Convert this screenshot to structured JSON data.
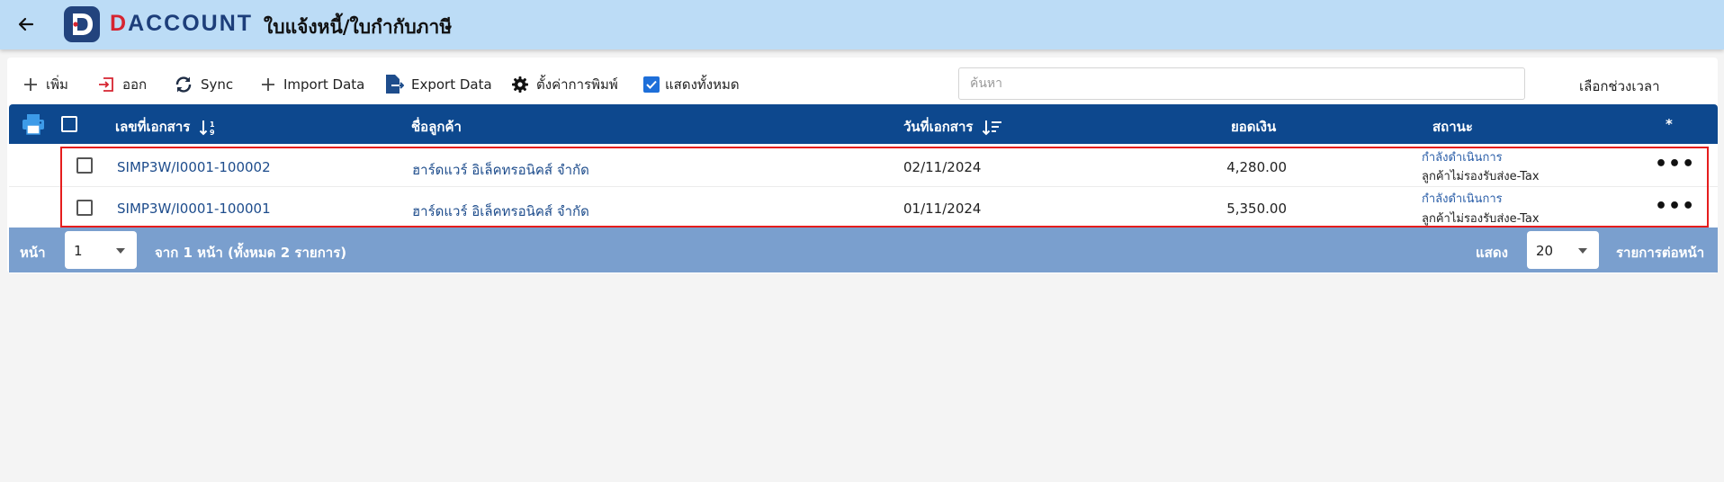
{
  "appbar": {
    "logo_red": "D",
    "logo_blue": "ACCOUNT",
    "title": "ใบแจ้งหนี้/ใบกำกับภาษี"
  },
  "toolbar": {
    "add_label": "เพิ่ม",
    "exit_label": "ออก",
    "sync_label": "Sync",
    "import_label": "Import Data",
    "export_label": "Export Data",
    "print_settings_label": "ตั้งค่าการพิมพ์",
    "show_all_label": "แสดงทั้งหมด",
    "show_all_checked": true,
    "search_placeholder": "ค้นหา",
    "search_value": "",
    "period_label": "เลือกช่วงเวลา"
  },
  "table": {
    "headers": {
      "doc_no": "เลขที่เอกสาร",
      "customer": "ชื่อลูกค้า",
      "doc_date": "วันที่เอกสาร",
      "amount": "ยอดเงิน",
      "status": "สถานะ",
      "actions": "*"
    },
    "rows": [
      {
        "doc_no": "SIMP3W/I0001-100002",
        "customer": "ฮาร์ดแวร์ อิเล็คทรอนิคส์ จำกัด",
        "doc_date": "02/11/2024",
        "amount": "4,280.00",
        "status_main": "กำลังดำเนินการ",
        "status_sub": "ลูกค้าไม่รองรับส่งe-Tax",
        "actions": "•••"
      },
      {
        "doc_no": "SIMP3W/I0001-100001",
        "customer": "ฮาร์ดแวร์ อิเล็คทรอนิคส์ จำกัด",
        "doc_date": "01/11/2024",
        "amount": "5,350.00",
        "status_main": "กำลังดำเนินการ",
        "status_sub": "ลูกค้าไม่รองรับส่งe-Tax",
        "actions": "•••"
      }
    ]
  },
  "pager": {
    "page_label": "หน้า",
    "page_value": "1",
    "page_info": "จาก 1 หน้า (ทั้งหมด 2 รายการ)",
    "show_label": "แสดง",
    "per_page_value": "20",
    "per_page_suffix": "รายการต่อหน้า"
  },
  "colors": {
    "appbar": "#bcdcf6",
    "header": "#0d488e",
    "pager": "#7a9fce",
    "highlight": "#e51d1d",
    "link": "#1d4c8c"
  },
  "icons": [
    "back-arrow-icon",
    "logo-icon",
    "plus-icon",
    "exit-icon",
    "sync-icon",
    "export-icon",
    "gear-icon",
    "checkbox-icon",
    "printer-icon",
    "sort-icon",
    "more-icon",
    "caret-down-icon"
  ]
}
